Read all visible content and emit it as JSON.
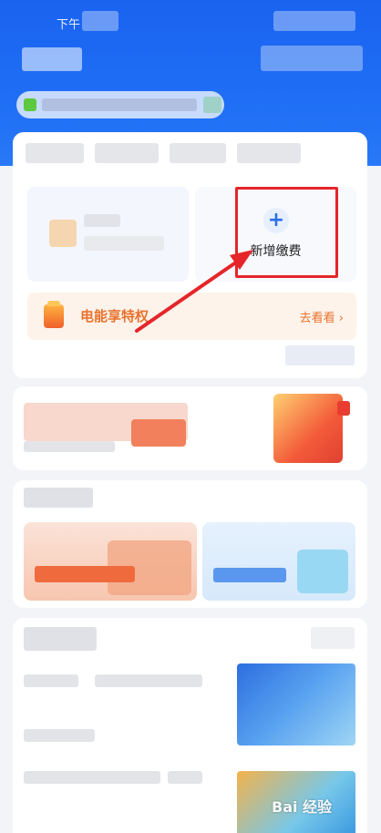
{
  "status_bar": {
    "time_text": "下午"
  },
  "services": {
    "add_payment": {
      "label": "新增缴费",
      "icon": "plus-icon",
      "icon_glyph": "+"
    }
  },
  "promo": {
    "title": "电能享特权",
    "link_text": "去看看",
    "link_chevron": "›"
  },
  "watermark": {
    "text": "Bai 经验"
  },
  "colors": {
    "header_blue": "#1a63f0",
    "accent_orange": "#e8722e",
    "add_icon_blue": "#2b6fe8",
    "annotation_red": "#e5252a"
  }
}
